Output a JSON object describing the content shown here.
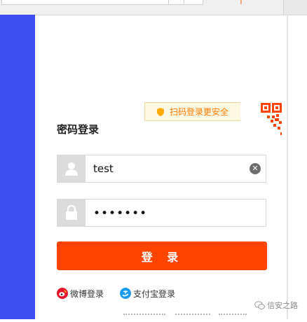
{
  "qr_tip": {
    "text": "扫码登录更安全"
  },
  "login_form": {
    "title": "密码登录",
    "username_value": "test",
    "password_value": "•••••••",
    "submit_label": "登 录"
  },
  "social_login": {
    "weibo_label": "微博登录",
    "alipay_label": "支付宝登录"
  },
  "watermark": {
    "text": "信安之路"
  },
  "colors": {
    "sidebar": "#3e4ff0",
    "accent": "#ff4400",
    "tip_text": "#ff7a00"
  },
  "icons": [
    "shield-icon",
    "qr-code-icon",
    "user-icon",
    "lock-icon",
    "clear-icon",
    "weibo-icon",
    "alipay-icon",
    "wechat-icon"
  ]
}
